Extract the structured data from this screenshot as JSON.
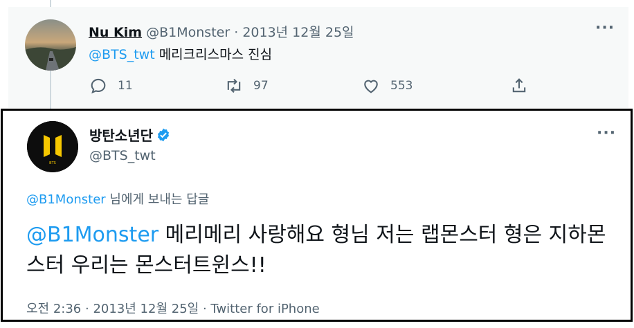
{
  "reply_tweet": {
    "name": "Nu Kim",
    "handle": "@B1Monster",
    "separator": "·",
    "date": "2013년 12월 25일",
    "mention": "@BTS_twt",
    "text": "메리크리스마스 진심",
    "replies": "11",
    "retweets": "97",
    "likes": "553",
    "more_icon": "more-horizontal-icon"
  },
  "main_tweet": {
    "name": "방탄소년단",
    "handle": "@BTS_twt",
    "verified_icon": "verified-badge-icon",
    "reply_to_mention": "@B1Monster",
    "reply_to_suffix": "님에게 보내는 답글",
    "mention": "@B1Monster",
    "text": "메리메리 사랑해요 형님 저는 랩몬스터 형은 지하몬스터 우리는 몬스터트윈스!!",
    "time": "오전 2:36",
    "separator1": "·",
    "date": "2013년 12월 25일",
    "separator2": "·",
    "source": "Twitter for iPhone",
    "avatar_text": "BTS"
  },
  "colors": {
    "accent": "#1d9bf0",
    "muted": "#536471",
    "text": "#0f1419",
    "logo_gold": "#f6c700"
  }
}
